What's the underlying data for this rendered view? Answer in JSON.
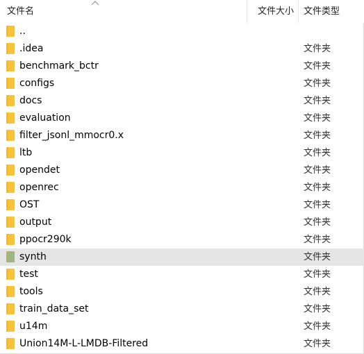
{
  "columns": {
    "name": "文件名",
    "size": "文件大小",
    "type": "文件类型",
    "sort_icon": "chevron-up-icon"
  },
  "colors": {
    "folder": "#f8c33a",
    "folder_synth": "#9cb486",
    "selected_row": "#e5e5e5"
  },
  "files": [
    {
      "name": "..",
      "type": "",
      "icon": "folder-icon"
    },
    {
      "name": ".idea",
      "type": "文件夹",
      "icon": "folder-icon"
    },
    {
      "name": "benchmark_bctr",
      "type": "文件夹",
      "icon": "folder-icon"
    },
    {
      "name": "configs",
      "type": "文件夹",
      "icon": "folder-icon"
    },
    {
      "name": "docs",
      "type": "文件夹",
      "icon": "folder-icon"
    },
    {
      "name": "evaluation",
      "type": "文件夹",
      "icon": "folder-icon"
    },
    {
      "name": "filter_jsonl_mmocr0.x",
      "type": "文件夹",
      "icon": "folder-icon"
    },
    {
      "name": "ltb",
      "type": "文件夹",
      "icon": "folder-icon"
    },
    {
      "name": "opendet",
      "type": "文件夹",
      "icon": "folder-icon"
    },
    {
      "name": "openrec",
      "type": "文件夹",
      "icon": "folder-icon"
    },
    {
      "name": "OST",
      "type": "文件夹",
      "icon": "folder-icon"
    },
    {
      "name": "output",
      "type": "文件夹",
      "icon": "folder-icon"
    },
    {
      "name": "ppocr290k",
      "type": "文件夹",
      "icon": "folder-icon"
    },
    {
      "name": "synth",
      "type": "文件夹",
      "icon": "folder-icon",
      "selected": true
    },
    {
      "name": "test",
      "type": "文件夹",
      "icon": "folder-icon"
    },
    {
      "name": "tools",
      "type": "文件夹",
      "icon": "folder-icon"
    },
    {
      "name": "train_data_set",
      "type": "文件夹",
      "icon": "folder-icon"
    },
    {
      "name": "u14m",
      "type": "文件夹",
      "icon": "folder-icon"
    },
    {
      "name": "Union14M-L-LMDB-Filtered",
      "type": "文件夹",
      "icon": "folder-icon"
    }
  ]
}
